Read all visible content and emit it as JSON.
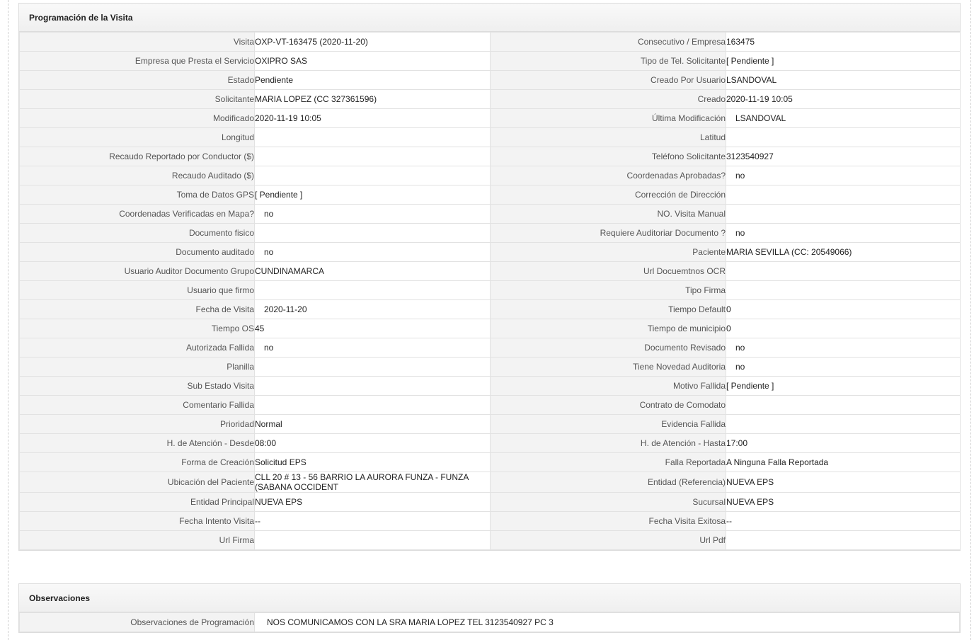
{
  "programacion": {
    "title": "Programación de la Visita",
    "rows": [
      {
        "l1": "Visita",
        "v1": "OXP-VT-163475 (2020-11-20)",
        "l2": "Consecutivo / Empresa",
        "v2": "163475"
      },
      {
        "l1": "Empresa que Presta el Servicio",
        "v1": "OXIPRO SAS",
        "l2": "Tipo de Tel. Solicitante",
        "v2": "[ Pendiente ]"
      },
      {
        "l1": "Estado",
        "v1": "Pendiente",
        "l2": "Creado Por Usuario",
        "v2": "LSANDOVAL"
      },
      {
        "l1": "Solicitante",
        "v1": "MARIA LOPEZ (CC 327361596)",
        "l2": "Creado",
        "v2": "2020-11-19 10:05"
      },
      {
        "l1": "Modificado",
        "v1": "2020-11-19 10:05",
        "l2": "Última Modificación",
        "v2": "LSANDOVAL"
      },
      {
        "l1": "Longitud",
        "v1": "",
        "l2": "Latitud",
        "v2": ""
      },
      {
        "l1": "Recaudo Reportado por Conductor ($)",
        "v1": "",
        "l2": "Teléfono Solicitante",
        "v2": "3123540927"
      },
      {
        "l1": "Recaudo Auditado ($)",
        "v1": "",
        "l2": "Coordenadas Aprobadas?",
        "v2": "no"
      },
      {
        "l1": "Toma de Datos GPS",
        "v1": "[ Pendiente ]",
        "l2": "Corrección de Dirección",
        "v2": ""
      },
      {
        "l1": "Coordenadas Verificadas en Mapa?",
        "v1": "no",
        "l2": "NO. Visita Manual",
        "v2": ""
      },
      {
        "l1": "Documento fisico",
        "v1": "",
        "l2": "Requiere Auditoriar Documento ?",
        "v2": "no"
      },
      {
        "l1": "Documento auditado",
        "v1": "no",
        "l2": "Paciente",
        "v2": "MARIA SEVILLA (CC: 20549066)"
      },
      {
        "l1": "Usuario Auditor Documento Grupo",
        "v1": "CUNDINAMARCA",
        "l2": "Url Docuemtnos OCR",
        "v2": ""
      },
      {
        "l1": "Usuario que firmo",
        "v1": "",
        "l2": "Tipo Firma",
        "v2": ""
      },
      {
        "l1": "Fecha de Visita",
        "v1": "2020-11-20",
        "l2": "Tiempo Default",
        "v2": "0"
      },
      {
        "l1": "Tiempo OS",
        "v1": "45",
        "l2": "Tiempo de municipio",
        "v2": "0"
      },
      {
        "l1": "Autorizada Fallida",
        "v1": "no",
        "l2": "Documento Revisado",
        "v2": "no"
      },
      {
        "l1": "Planilla",
        "v1": "",
        "l2": "Tiene Novedad Auditoria",
        "v2": "no"
      },
      {
        "l1": "Sub Estado Visita",
        "v1": "",
        "l2": "Motivo Fallida",
        "v2": "[ Pendiente ]"
      },
      {
        "l1": "Comentario Fallida",
        "v1": "",
        "l2": "Contrato de Comodato",
        "v2": ""
      },
      {
        "l1": "Prioridad",
        "v1": "Normal",
        "l2": "Evidencia Fallida",
        "v2": ""
      },
      {
        "l1": "H. de Atención - Desde",
        "v1": "08:00",
        "l2": "H. de Atención - Hasta",
        "v2": "17:00"
      },
      {
        "l1": "Forma de Creación",
        "v1": "Solicitud EPS",
        "l2": "Falla Reportada",
        "v2": "A Ninguna Falla Reportada"
      },
      {
        "l1": "Ubicación del Paciente",
        "v1": "CLL 20 # 13 - 56 BARRIO LA AURORA FUNZA - FUNZA (SABANA OCCIDENT",
        "l2": "Entidad (Referencia)",
        "v2": "NUEVA EPS"
      },
      {
        "l1": "Entidad Principal",
        "v1": "NUEVA EPS",
        "l2": "Sucursal",
        "v2": "NUEVA EPS"
      },
      {
        "l1": "Fecha Intento Visita",
        "v1": "--",
        "l2": "Fecha Visita Exitosa",
        "v2": "--"
      },
      {
        "l1": "Url Firma",
        "v1": "",
        "l2": "Url Pdf",
        "v2": ""
      }
    ]
  },
  "observaciones": {
    "title": "Observaciones",
    "label": "Observaciones de Programación",
    "value": "NOS COMUNICAMOS CON LA SRA MARIA LOPEZ TEL 3123540927 PC 3"
  }
}
